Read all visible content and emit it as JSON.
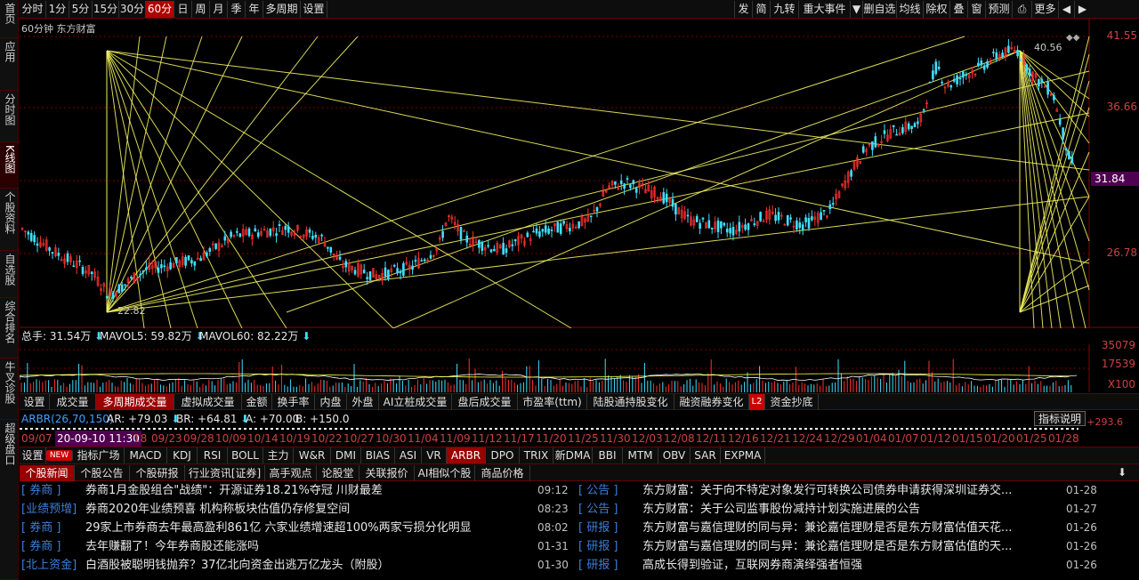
{
  "leftnav": [
    "首页",
    "应用",
    "分时图",
    "K线图",
    "个股资料",
    "自选股",
    "综合排名",
    "牛叉诊股",
    "超级盘口"
  ],
  "topbar": {
    "periods": [
      "分时",
      "1分",
      "5分",
      "15分",
      "30分",
      "60分",
      "日",
      "周",
      "月",
      "季",
      "年",
      "多周期",
      "设置"
    ],
    "active_period": "60分",
    "right": [
      "发",
      "简",
      "九转",
      "重大事件",
      "▼",
      "删自选",
      "均线",
      "除权",
      "叠",
      "窗",
      "预测",
      "⎙",
      "更多",
      "◀",
      "▶"
    ]
  },
  "chart": {
    "title": "60分钟  东方财富",
    "price_labels": [
      "41.55",
      "36.66",
      "31.84",
      "26.78"
    ],
    "current_price": "31.84",
    "high_marker": "40.56",
    "low_marker": "22.82",
    "diamond": "◆◆"
  },
  "volume": {
    "total": "总手: 31.54万",
    "mavol5": "MAVOL5: 59.82万",
    "mavol60": "MAVOL60: 82.22万",
    "labels": [
      "35079",
      "17539",
      "X100"
    ]
  },
  "indicator_tabs": [
    "设置",
    "成交量",
    "多周期成交量",
    "虚拟成交量",
    "金额",
    "换手率",
    "内盘",
    "外盘",
    "AI立桩成交量",
    "盘后成交量",
    "市盈率(ttm)",
    "陆股通持股变化",
    "融资融券变化",
    "L2",
    "资金抄底"
  ],
  "arbr": {
    "label": "ARBR(26,70,150)",
    "ar": "AR: +79.03",
    "br": "BR: +64.81",
    "a": "A: +70.00",
    "b": "B: +150.0",
    "explain": "指标说明",
    "right_value": "+293.6"
  },
  "dates": [
    "09/07",
    "20-09-10 11:30",
    "18",
    "09/23",
    "09/28",
    "10/09",
    "10/14",
    "10/19",
    "10/22",
    "10/27",
    "10/30",
    "11/04",
    "11/09",
    "11/12",
    "11/17",
    "11/20",
    "11/25",
    "11/30",
    "12/03",
    "12/08",
    "12/11",
    "12/16",
    "12/21",
    "12/24",
    "12/29",
    "01/04",
    "01/07",
    "01/12",
    "01/15",
    "01/20",
    "01/25",
    "01/28"
  ],
  "bottom_tabs": [
    "设置",
    "NEW",
    "指标广场",
    "MACD",
    "KDJ",
    "RSI",
    "BOLL",
    "主力",
    "W&R",
    "DMI",
    "BIAS",
    "ASI",
    "VR",
    "ARBR",
    "DPO",
    "TRIX",
    "新DMA",
    "BBI",
    "MTM",
    "OBV",
    "SAR",
    "EXPMA"
  ],
  "news_tabs": [
    "个股新闻",
    "个股公告",
    "个股研报",
    "行业资讯[证券]",
    "高手观点",
    "论股堂",
    "关联报价",
    "AI相似个股",
    "商品价格"
  ],
  "news_left": [
    {
      "tag": "[ 券商 ]",
      "title": "券商1月金股组合\"战绩\"：开源证券18.21%夺冠 川财最差",
      "time": "09:12"
    },
    {
      "tag": "[业绩预增]",
      "title": "券商2020年业绩预喜 机构称板块估值仍存修复空间",
      "time": "08:23"
    },
    {
      "tag": "[ 券商 ]",
      "title": "29家上市券商去年最高盈利861亿 六家业绩增速超100%两家亏损分化明显",
      "time": "08:02"
    },
    {
      "tag": "[ 券商 ]",
      "title": "去年赚翻了！今年券商股还能涨吗",
      "time": "01-31"
    },
    {
      "tag": "[北上资金]",
      "title": "白酒股被聪明钱抛弃？37亿北向资金出逃万亿龙头（附股）",
      "time": "01-30"
    }
  ],
  "news_right": [
    {
      "tag": "[ 公告 ]",
      "title": "东方财富：关于向不特定对象发行可转换公司债券申请获得深圳证券交...",
      "time": "01-28"
    },
    {
      "tag": "[ 公告 ]",
      "title": "东方财富：关于公司监事股份减持计划实施进展的公告",
      "time": "01-27"
    },
    {
      "tag": "[ 研报 ]",
      "title": "东方财富与嘉信理财的同与异：兼论嘉信理财是否是东方财富估值天花...",
      "time": "01-26"
    },
    {
      "tag": "[ 研报 ]",
      "title": "东方财富与嘉信理财的同与异：兼论嘉信理财是否是东方财富估值的天...",
      "time": "01-26"
    },
    {
      "tag": "[ 研报 ]",
      "title": "高成长得到验证，互联网券商演绎强者恒强",
      "time": "01-26"
    }
  ],
  "colors": {
    "up": "#ff3030",
    "down": "#40e0ff",
    "gann": "#f0f060",
    "accent": "#b00000"
  }
}
